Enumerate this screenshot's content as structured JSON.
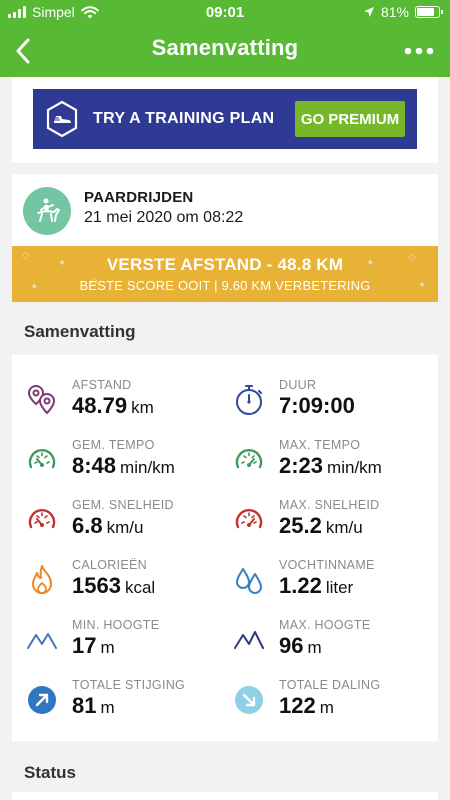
{
  "status_bar": {
    "carrier": "Simpel",
    "time": "09:01",
    "battery": "81%",
    "battery_level": 0.81
  },
  "nav": {
    "title": "Samenvatting",
    "back_icon": "chevron-left-icon",
    "more_icon": "more-dots-icon"
  },
  "banner": {
    "text": "TRY A TRAINING PLAN",
    "button": "GO PREMIUM",
    "icon": "shoe-shield-icon"
  },
  "activity": {
    "type": "PAARDRIJDEN",
    "date": "21 mei 2020 om 08:22",
    "icon": "horse-riding-icon",
    "record_title": "VERSTE AFSTAND - 48.8 KM",
    "record_subtitle": "BESTE SCORE OOIT  |  9.60 KM VERBETERING"
  },
  "summary": {
    "title": "Samenvatting",
    "stats": [
      {
        "label": "AFSTAND",
        "value": "48.79",
        "unit": "km",
        "icon": "location-pins-icon"
      },
      {
        "label": "DUUR",
        "value": "7:09:00",
        "unit": "",
        "icon": "stopwatch-icon"
      },
      {
        "label": "GEM. TEMPO",
        "value": "8:48",
        "unit": "min/km",
        "icon": "speedometer-icon"
      },
      {
        "label": "MAX. TEMPO",
        "value": "2:23",
        "unit": "min/km",
        "icon": "speedometer-icon"
      },
      {
        "label": "GEM. SNELHEID",
        "value": "6.8",
        "unit": "km/u",
        "icon": "speedometer-icon"
      },
      {
        "label": "MAX. SNELHEID",
        "value": "25.2",
        "unit": "km/u",
        "icon": "speedometer-icon"
      },
      {
        "label": "CALORIEËN",
        "value": "1563",
        "unit": "kcal",
        "icon": "flame-icon"
      },
      {
        "label": "VOCHTINNAME",
        "value": "1.22",
        "unit": "liter",
        "icon": "water-drops-icon"
      },
      {
        "label": "MIN. HOOGTE",
        "value": "17",
        "unit": "m",
        "icon": "mountains-icon"
      },
      {
        "label": "MAX. HOOGTE",
        "value": "96",
        "unit": "m",
        "icon": "mountains-icon"
      },
      {
        "label": "TOTALE STIJGING",
        "value": "81",
        "unit": "m",
        "icon": "arrow-up-right-icon"
      },
      {
        "label": "TOTALE DALING",
        "value": "122",
        "unit": "m",
        "icon": "arrow-down-right-icon"
      }
    ]
  },
  "status_section": {
    "title": "Status"
  },
  "colors": {
    "header_green": "#58b935",
    "banner_blue": "#2e3a94",
    "premium_green": "#76b82a",
    "record_gold": "#e7b235",
    "activity_icon_bg": "#74c6a2"
  }
}
